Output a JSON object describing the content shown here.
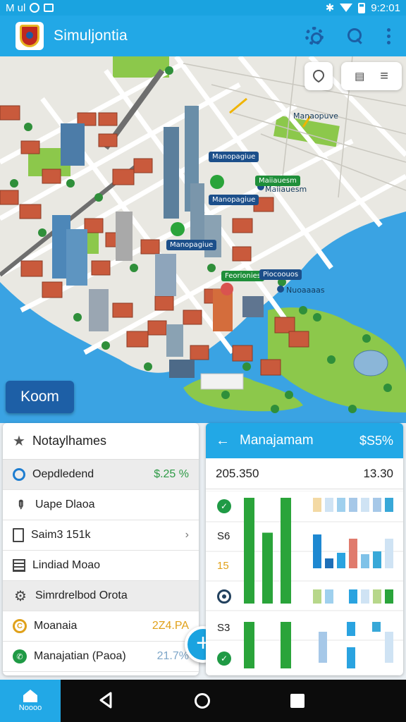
{
  "status_bar": {
    "left_text": "M ul",
    "time": "9:2:01"
  },
  "app_bar": {
    "title": "Simuljontia",
    "icons": [
      "logo-crest",
      "gear-icon",
      "search-icon",
      "more-vert-icon"
    ]
  },
  "map": {
    "labels": [
      "Manaopuve",
      "Manopagiue",
      "Maiiauesm",
      "Feorionies",
      "Piocoouos",
      "Nuoaaaas"
    ],
    "zoom_button": "Koom",
    "colors": {
      "water": "#3aa3e3",
      "land": "#e9e8e2",
      "park": "#8cc84b",
      "roof": "#c95a3c"
    }
  },
  "left_panel": {
    "title": "Notaylhames",
    "rows": [
      {
        "icon": "circle-blue-icon",
        "label": "Oepdledend",
        "value": "$.25 %",
        "value_color": "#2e9a46",
        "shaded": true
      },
      {
        "icon": "pencil-icon",
        "label": "Uape Dlaoa",
        "value": "",
        "shaded": false
      },
      {
        "icon": "document-icon",
        "label": "Saim3 151k",
        "value": "›",
        "value_color": "#777",
        "shaded": false
      },
      {
        "icon": "list-icon",
        "label": "Lindiad Moao",
        "value": "",
        "shaded": false
      },
      {
        "icon": "settings-icon",
        "label": "Simrdrelbod Orota",
        "value": "",
        "shaded": true
      },
      {
        "icon": "coin-icon",
        "label": "Moanaia",
        "value": "2Z4.PA",
        "value_color": "#e0a11a",
        "shaded": false
      },
      {
        "icon": "chat-icon",
        "label": "Manajatian (Paoa)",
        "value": "21.7%",
        "value_color": "#7da6c8",
        "shaded": false
      }
    ]
  },
  "fab": {
    "label": "+"
  },
  "right_panel": {
    "title": "Manajamam",
    "header_value": "$S5%",
    "sub_left": "205.350",
    "sub_right": "13.30",
    "row_labels": [
      "",
      "S6",
      "15",
      "",
      "S3"
    ],
    "chart_data": {
      "type": "bar",
      "series": [
        {
          "values": [
            1.0,
            0.67,
            1.0
          ],
          "color": "#2aa43a"
        },
        {
          "values": [
            0.2,
            0.2,
            0.2,
            0.2,
            0.2,
            0.2,
            0.2
          ],
          "color": "#a6c8e8"
        }
      ]
    }
  },
  "nav_bar": {
    "home_label": "Noooo"
  }
}
